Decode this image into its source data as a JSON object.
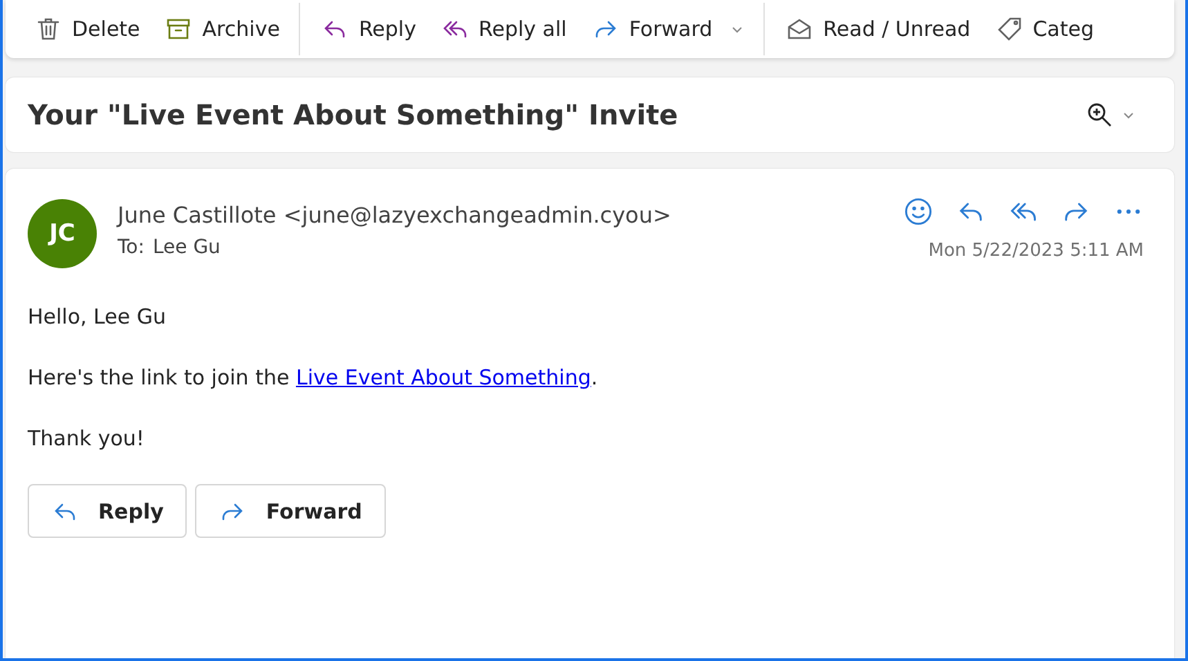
{
  "toolbar": [
    {
      "kind": "delete",
      "label": "Delete",
      "dropdown": false,
      "divider_after": false
    },
    {
      "kind": "archive",
      "label": "Archive",
      "dropdown": false,
      "divider_after": true
    },
    {
      "kind": "reply",
      "label": "Reply",
      "dropdown": false,
      "divider_after": false
    },
    {
      "kind": "reply_all",
      "label": "Reply all",
      "dropdown": false,
      "divider_after": false
    },
    {
      "kind": "forward",
      "label": "Forward",
      "dropdown": true,
      "divider_after": true
    },
    {
      "kind": "read",
      "label": "Read / Unread",
      "dropdown": false,
      "divider_after": false
    },
    {
      "kind": "category",
      "label": "Categ",
      "dropdown": false,
      "divider_after": false
    }
  ],
  "subject": "Your \"Live Event About Something\" Invite",
  "message": {
    "avatar_initials": "JC",
    "sender": "June Castillote <june@lazyexchangeadmin.cyou>",
    "to_label": "To:",
    "to": "Lee Gu",
    "date": "Mon 5/22/2023 5:11 AM",
    "actions": [
      {
        "kind": "emoji"
      },
      {
        "kind": "reply"
      },
      {
        "kind": "reply_all"
      },
      {
        "kind": "forward"
      },
      {
        "kind": "more"
      }
    ],
    "body": {
      "greeting": "Hello, Lee Gu",
      "link_before": "Here's the link to join the ",
      "link": "Live Event About Something",
      "link_after": ".",
      "closing": "Thank you!"
    },
    "buttons": [
      {
        "kind": "reply",
        "label": "Reply"
      },
      {
        "kind": "forward",
        "label": "Forward"
      }
    ]
  }
}
